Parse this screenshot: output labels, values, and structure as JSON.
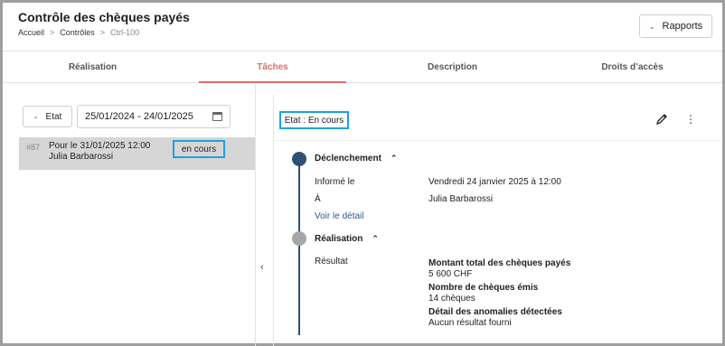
{
  "header": {
    "title": "Contrôle des chèques payés",
    "breadcrumb": [
      "Accueil",
      "Contrôles",
      "Ctrl-100"
    ],
    "reports_label": "Rapports"
  },
  "tabs": [
    {
      "label": "Réalisation"
    },
    {
      "label": "Tâches"
    },
    {
      "label": "Description"
    },
    {
      "label": "Droits d’accès"
    }
  ],
  "active_tab": "Tâches",
  "filters": {
    "etat_label": "Etat",
    "date_range": "25/01/2024 - 24/01/2025"
  },
  "task_list": [
    {
      "id": "#87",
      "line1": "Pour le 31/01/2025 12:00",
      "line2": "Julia Barbarossi",
      "status": "en cours"
    }
  ],
  "detail": {
    "state_label": "Etat : En cours",
    "declenchement": {
      "title": "Déclenchement",
      "informe_label": "Informé le",
      "informe_value": "Vendredi 24 janvier 2025 à 12:00",
      "a_label": "À",
      "a_value": "Julia Barbarossi",
      "detail_link": "Voir le détail"
    },
    "realisation": {
      "title": "Réalisation",
      "resultat_label": "Résultat",
      "results": [
        {
          "title": "Montant total des chèques payés",
          "value": "5 600 CHF"
        },
        {
          "title": "Nombre de chèques émis",
          "value": "14 chèques"
        },
        {
          "title": "Détail des anomalies détectées",
          "value": "Aucun résultat fourni"
        }
      ]
    }
  },
  "colors": {
    "accent_tab": "#e26b6b",
    "timeline_active": "#2f5075",
    "timeline_pending": "#a7a7a7",
    "highlight_box": "#1ea1dc",
    "selected_row": "#d6d6d6"
  }
}
